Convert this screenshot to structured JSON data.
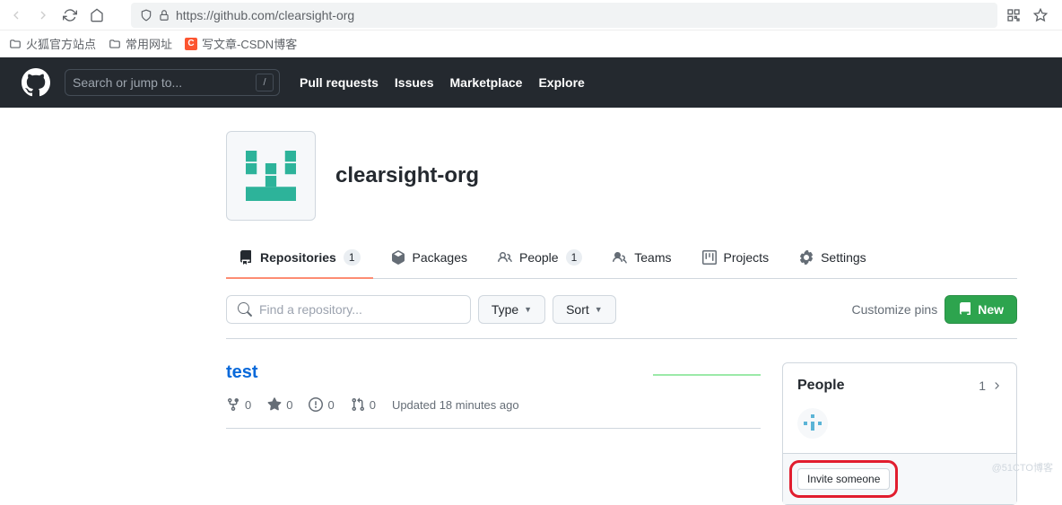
{
  "browser": {
    "url": "https://github.com/clearsight-org"
  },
  "bookmarks": [
    {
      "label": "火狐官方站点",
      "type": "folder"
    },
    {
      "label": "常用网址",
      "type": "folder"
    },
    {
      "label": "写文章-CSDN博客",
      "type": "csdn"
    }
  ],
  "github_header": {
    "search_placeholder": "Search or jump to...",
    "nav": [
      "Pull requests",
      "Issues",
      "Marketplace",
      "Explore"
    ]
  },
  "org": {
    "name": "clearsight-org"
  },
  "tabs": [
    {
      "label": "Repositories",
      "count": "1",
      "active": true,
      "icon": "repo"
    },
    {
      "label": "Packages",
      "icon": "package"
    },
    {
      "label": "People",
      "count": "1",
      "icon": "people"
    },
    {
      "label": "Teams",
      "icon": "team"
    },
    {
      "label": "Projects",
      "icon": "project"
    },
    {
      "label": "Settings",
      "icon": "gear"
    }
  ],
  "filter": {
    "find_placeholder": "Find a repository...",
    "type_btn": "Type",
    "sort_btn": "Sort",
    "customize": "Customize pins",
    "new_btn": "New"
  },
  "repo": {
    "name": "test",
    "forks": "0",
    "stars": "0",
    "issues": "0",
    "prs": "0",
    "updated": "Updated 18 minutes ago"
  },
  "people_box": {
    "title": "People",
    "count": "1",
    "invite": "Invite someone"
  },
  "watermark": "@51CTO博客"
}
